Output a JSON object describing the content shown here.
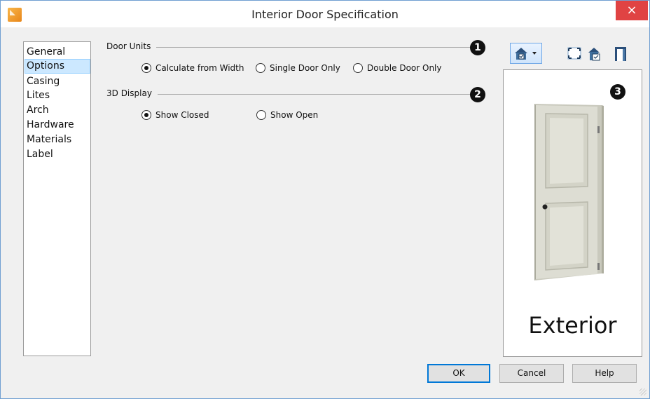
{
  "window": {
    "title": "Interior Door Specification",
    "close_glyph": "×"
  },
  "nav": {
    "items": [
      {
        "label": "General",
        "selected": false
      },
      {
        "label": "Options",
        "selected": true
      },
      {
        "label": "Casing",
        "selected": false
      },
      {
        "label": "Lites",
        "selected": false
      },
      {
        "label": "Arch",
        "selected": false
      },
      {
        "label": "Hardware",
        "selected": false
      },
      {
        "label": "Materials",
        "selected": false
      },
      {
        "label": "Label",
        "selected": false
      }
    ]
  },
  "door_units": {
    "label": "Door Units",
    "callout": "1",
    "options": [
      "Calculate from Width",
      "Single Door Only",
      "Double Door Only"
    ],
    "selected": "Calculate from Width"
  },
  "display_3d": {
    "label": "3D Display",
    "callout": "2",
    "options": [
      "Show Closed",
      "Show Open"
    ],
    "selected": "Show Closed"
  },
  "toolbar": {
    "icons": [
      "view-options-dropdown-icon",
      "fill-window-icon",
      "preview-options-icon",
      "door-swing-icon"
    ]
  },
  "preview": {
    "label": "Exterior",
    "callout": "3",
    "door_color": "#ddddd3"
  },
  "buttons": {
    "ok": "OK",
    "cancel": "Cancel",
    "help": "Help"
  }
}
